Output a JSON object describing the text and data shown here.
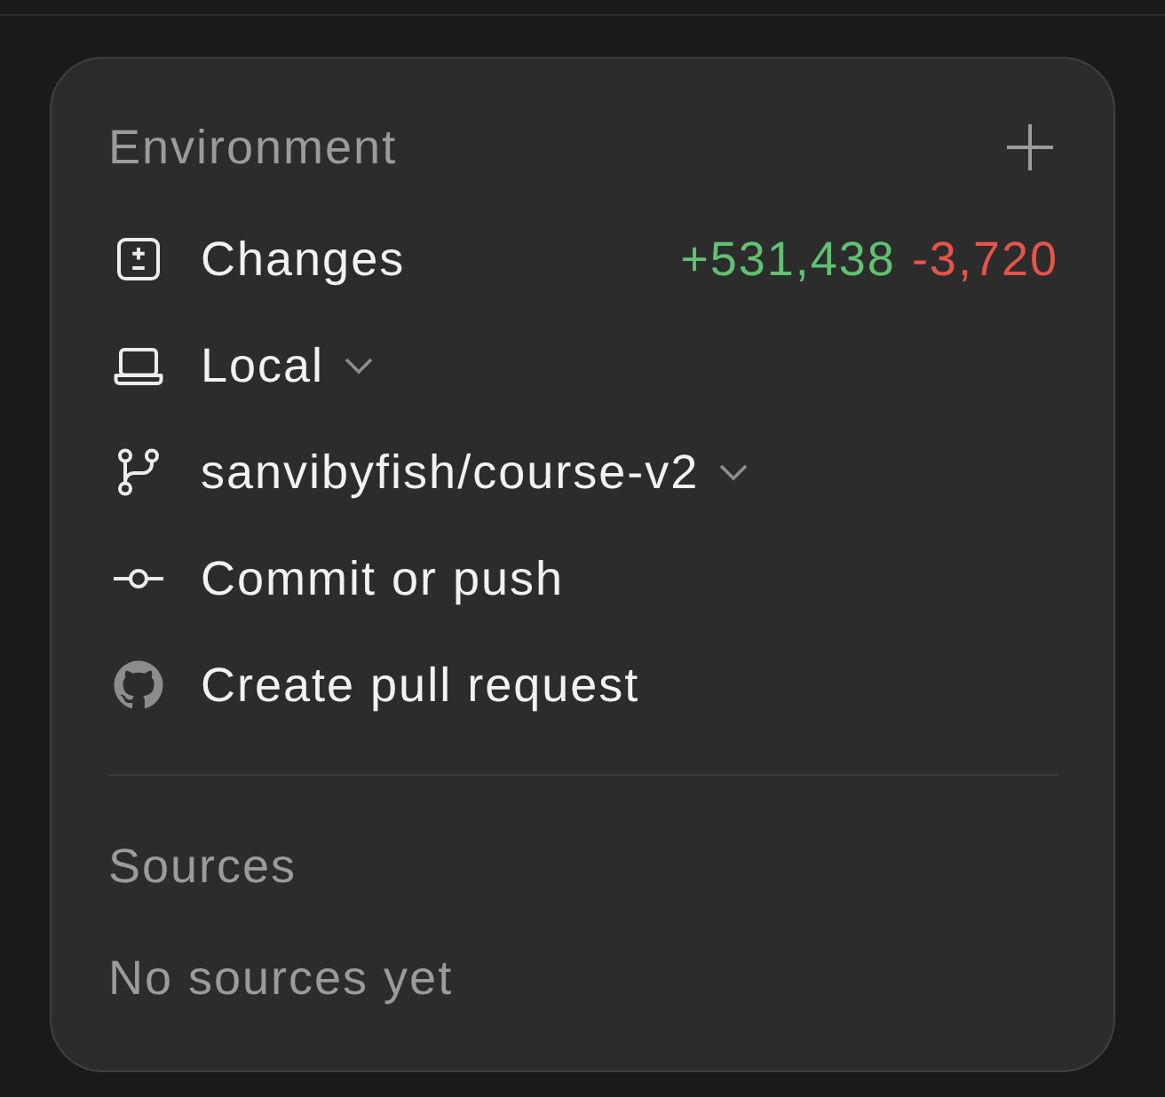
{
  "environment": {
    "title": "Environment",
    "items": [
      {
        "kind": "changes",
        "label": "Changes",
        "dropdown": false,
        "additions": "+531,438",
        "deletions": "-3,720"
      },
      {
        "kind": "local",
        "label": "Local",
        "dropdown": true
      },
      {
        "kind": "branch",
        "label": "sanvibyfish/course-v2",
        "dropdown": true
      },
      {
        "kind": "commit",
        "label": "Commit or push",
        "dropdown": false
      },
      {
        "kind": "pull-request",
        "label": "Create pull request",
        "dropdown": false
      }
    ]
  },
  "sources": {
    "title": "Sources",
    "empty_message": "No sources yet"
  }
}
